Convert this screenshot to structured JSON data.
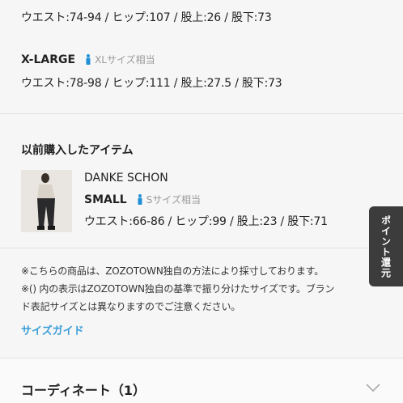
{
  "sizes": [
    {
      "name": "",
      "equiv": "",
      "measurements": "ウエスト:74-94 / ヒップ:107 / 股上:26 / 股下:73"
    },
    {
      "name": "X-LARGE",
      "equiv": "XLサイズ相当",
      "measurements": "ウエスト:78-98 / ヒップ:111 / 股上:27.5 / 股下:73"
    }
  ],
  "previous": {
    "heading": "以前購入したアイテム",
    "item": {
      "brand": "DANKE SCHON",
      "size": "SMALL",
      "equiv": "Sサイズ相当",
      "measurements": "ウエスト:66-86 / ヒップ:99 / 股上:23 / 股下:71"
    }
  },
  "notes": {
    "line1": "※こちらの商品は、ZOZOTOWN独自の方法により採寸しております。",
    "line2": "※() 内の表示はZOZOTOWN独自の基準で振り分けたサイズです。ブラン",
    "line3": "ド表記サイズとは異なりますのでご注意ください。",
    "size_guide": "サイズガイド"
  },
  "point_tab": "ポイント還元",
  "coordinate": {
    "label": "コーディネート（1）"
  },
  "colors": {
    "accent": "#3a9ed8",
    "person_icon": "#1f8fd6",
    "tab_bg": "#3c3c3c"
  }
}
